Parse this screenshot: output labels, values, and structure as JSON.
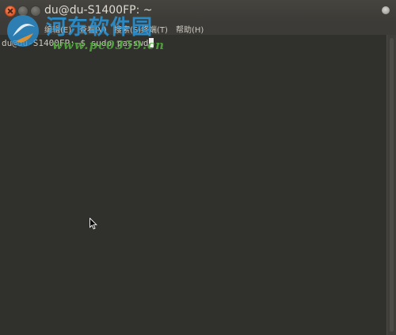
{
  "window": {
    "title": "du@du-S1400FP: ~"
  },
  "menubar": {
    "items": [
      {
        "label": "编辑(E)"
      },
      {
        "label": "查看(V)"
      },
      {
        "label": "搜索(S)"
      },
      {
        "label": "终端(T)"
      },
      {
        "label": "帮助(H)"
      }
    ]
  },
  "terminal": {
    "prompt": "du@du-S1400FP:~$",
    "command": " sudo passwd"
  },
  "watermark": {
    "title": "河东软件园",
    "url": "www.pc0359.cn"
  },
  "colors": {
    "terminal_bg": "#30302c",
    "titlebar_bg": "#3c3b37",
    "close_button": "#e25b2b",
    "text": "#c9c6bf",
    "watermark_blue": "#2896dc",
    "watermark_green": "#50aa3c"
  }
}
